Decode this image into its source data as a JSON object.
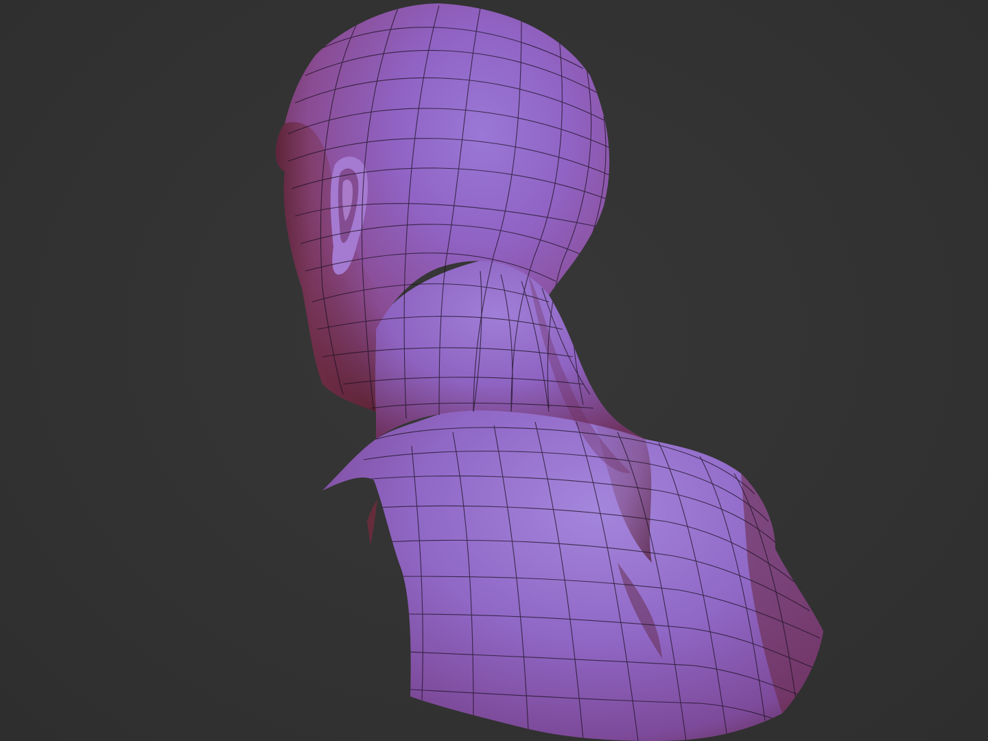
{
  "scene": {
    "subject": "sculpted-head-bust",
    "colors": {
      "background": "#333333",
      "material_light": "#8a5fc4",
      "material_mid": "#9a4f93",
      "material_dark": "#6b2a3e",
      "wireframe": "#1b1020"
    }
  }
}
